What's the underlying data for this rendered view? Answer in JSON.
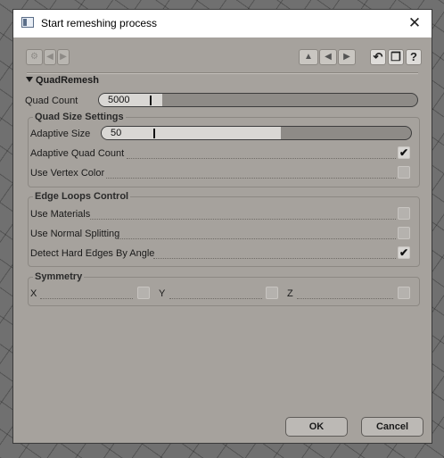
{
  "window": {
    "title": "Start remeshing process",
    "close_glyph": "✕"
  },
  "toolbar": {
    "left_buttons": [
      {
        "icon": "wrench-icon",
        "glyph": "⚙"
      },
      {
        "icon": "arrow-left-icon",
        "glyph": "◀"
      },
      {
        "icon": "arrow-right-icon",
        "glyph": "▶"
      }
    ],
    "right_buttons": [
      {
        "icon": "arrow-up-icon",
        "glyph": "▲"
      },
      {
        "icon": "arrow-left-icon",
        "glyph": "◀"
      },
      {
        "icon": "arrow-right-icon",
        "glyph": "▶"
      },
      {
        "icon": "undo-icon",
        "glyph": "↶"
      },
      {
        "icon": "copy-icon",
        "glyph": "❐"
      },
      {
        "icon": "help-icon",
        "glyph": "?"
      }
    ]
  },
  "section": {
    "title": "QuadRemesh"
  },
  "quad_count": {
    "label": "Quad Count",
    "value": "5000",
    "fill_fraction": 0.2
  },
  "quad_size": {
    "title": "Quad Size Settings",
    "adaptive_size": {
      "label": "Adaptive Size",
      "value": "50",
      "fill_fraction": 0.58
    },
    "adaptive_quad_count": {
      "label": "Adaptive Quad Count",
      "checked": true
    },
    "use_vertex_color": {
      "label": "Use Vertex Color",
      "checked": false
    }
  },
  "edge_loops": {
    "title": "Edge Loops Control",
    "use_materials": {
      "label": "Use Materials",
      "checked": false
    },
    "use_normal_splitting": {
      "label": "Use Normal Splitting",
      "checked": false
    },
    "detect_hard_edges": {
      "label": "Detect Hard Edges By Angle",
      "checked": true
    }
  },
  "symmetry": {
    "title": "Symmetry",
    "x": {
      "label": "X",
      "checked": false
    },
    "y": {
      "label": "Y",
      "checked": false
    },
    "z": {
      "label": "Z",
      "checked": false
    }
  },
  "check_glyph": "✔",
  "footer": {
    "ok_label": "OK",
    "cancel_label": "Cancel"
  }
}
